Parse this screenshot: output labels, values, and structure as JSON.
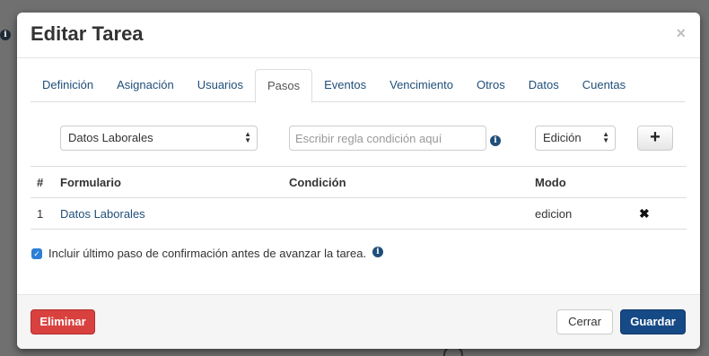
{
  "modal": {
    "title": "Editar Tarea",
    "close_symbol": "×"
  },
  "tabs": [
    {
      "label": "Definición",
      "active": false
    },
    {
      "label": "Asignación",
      "active": false
    },
    {
      "label": "Usuarios",
      "active": false
    },
    {
      "label": "Pasos",
      "active": true
    },
    {
      "label": "Eventos",
      "active": false
    },
    {
      "label": "Vencimiento",
      "active": false
    },
    {
      "label": "Otros",
      "active": false
    },
    {
      "label": "Datos",
      "active": false
    },
    {
      "label": "Cuentas",
      "active": false
    }
  ],
  "controls": {
    "form_select_value": "Datos Laborales",
    "condition_placeholder": "Escribir regla condición aquí",
    "mode_select_value": "Edición",
    "add_symbol": "+",
    "info_symbol": "i"
  },
  "table": {
    "headers": {
      "num": "#",
      "form": "Formulario",
      "condition": "Condición",
      "mode": "Modo"
    },
    "rows": [
      {
        "num": "1",
        "form": "Datos Laborales",
        "condition": "",
        "mode": "edicion",
        "delete_symbol": "✖"
      }
    ]
  },
  "checkbox": {
    "label": "Incluir último paso de confirmación antes de avanzar la tarea.",
    "checked": true,
    "check_symbol": "✓"
  },
  "footer": {
    "delete_label": "Eliminar",
    "close_label": "Cerrar",
    "save_label": "Guardar"
  },
  "colors": {
    "primary": "#164a86",
    "danger": "#d9413f",
    "link": "#1f4e79"
  }
}
